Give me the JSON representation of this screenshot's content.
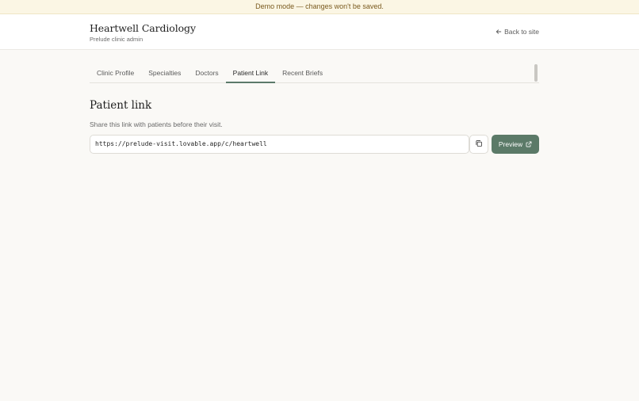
{
  "banner": {
    "text": "Demo mode — changes won't be saved."
  },
  "header": {
    "title": "Heartwell Cardiology",
    "subtitle": "Prelude clinic admin",
    "back_label": "Back to site",
    "back_icon": "arrow-left-icon"
  },
  "tabs": [
    {
      "label": "Clinic Profile",
      "active": false
    },
    {
      "label": "Specialties",
      "active": false
    },
    {
      "label": "Doctors",
      "active": false
    },
    {
      "label": "Patient Link",
      "active": true
    },
    {
      "label": "Recent Briefs",
      "active": false
    }
  ],
  "patient_link": {
    "title": "Patient link",
    "description": "Share this link with patients before their visit.",
    "url": "https://prelude-visit.lovable.app/c/heartwell",
    "copy_icon": "copy-icon",
    "preview_label": "Preview",
    "preview_icon": "external-link-icon"
  },
  "colors": {
    "accent": "#5b7a68",
    "banner_bg": "#fbf6e4",
    "banner_text": "#7a5a1e",
    "page_bg": "#faf9f6"
  }
}
